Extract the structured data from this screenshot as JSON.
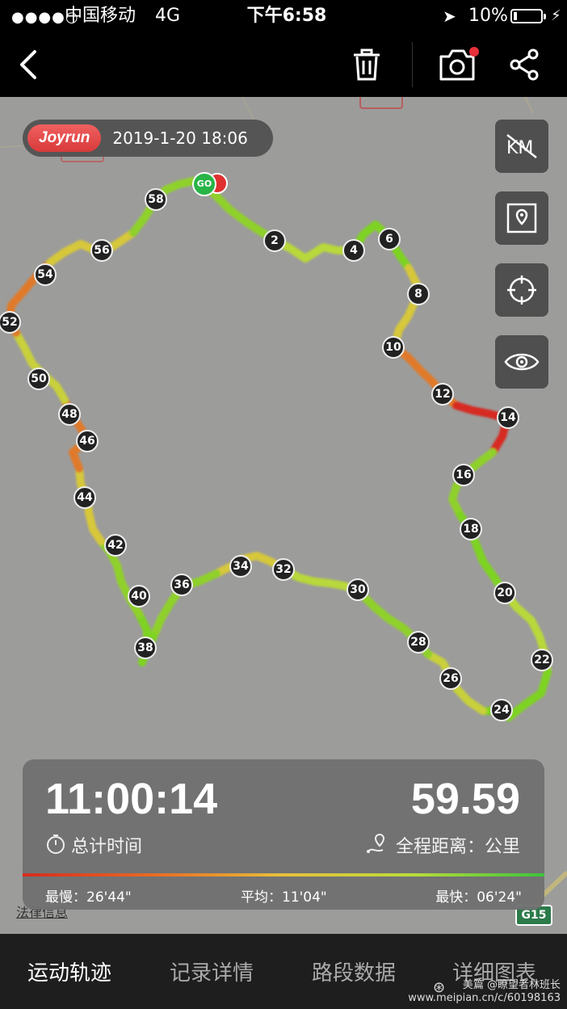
{
  "status_bar": {
    "signal": "●●●●○",
    "carrier": "中国移动",
    "network": "4G",
    "time": "下午6:58",
    "battery": "10%",
    "location_arrow": "➤",
    "charging": "⚡"
  },
  "toolbar": {
    "back_icon": "chevron-left-icon",
    "delete_icon": "trash-icon",
    "camera_icon": "camera-icon",
    "share_icon": "share-icon"
  },
  "map": {
    "brand": "Joyrun",
    "datetime": "2019-1-20 18:06",
    "start_label": "GO",
    "controls": [
      "km-toggle-icon",
      "map-style-icon",
      "locate-icon",
      "eye-icon"
    ],
    "km_markers": [
      "2",
      "4",
      "6",
      "8",
      "10",
      "12",
      "14",
      "16",
      "18",
      "20",
      "22",
      "24",
      "26",
      "28",
      "30",
      "32",
      "34",
      "36",
      "38",
      "40",
      "42",
      "44",
      "46",
      "48",
      "50",
      "52",
      "54",
      "56",
      "58"
    ],
    "legal_text": "法律信息",
    "road_shield": "G15"
  },
  "stats": {
    "duration": "11:00:14",
    "duration_label": "总计时间",
    "distance": "59.59",
    "distance_label": "全程距离：公里",
    "slowest": "最慢：26'44\"",
    "average": "平均：11'04\"",
    "fastest": "最快：06'24\""
  },
  "tabs": {
    "track": "运动轨迹",
    "details": "记录详情",
    "splits": "路段数据",
    "charts": "详细图表"
  },
  "watermark": {
    "line1": "美篇 @瞭望者林班长",
    "line2": "www.meipian.cn/c/60198163"
  },
  "colors": {
    "route_fast": "#7ed321",
    "route_medium": "#d6c73a",
    "route_slow": "#e07a2c",
    "route_slowest": "#d62b20",
    "brand_red": "#e04848"
  }
}
